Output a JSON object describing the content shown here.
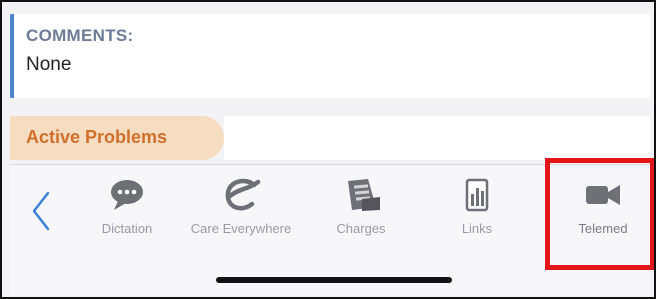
{
  "comments": {
    "label": "COMMENTS:",
    "value": "None"
  },
  "active_problems": {
    "label": "Active Problems"
  },
  "toolbar": {
    "items": [
      {
        "label": "Dictation",
        "icon": "dictation-icon"
      },
      {
        "label": "Care Everywhere",
        "icon": "care-everywhere-icon"
      },
      {
        "label": "Charges",
        "icon": "charges-icon"
      },
      {
        "label": "Links",
        "icon": "links-icon"
      },
      {
        "label": "Telemed",
        "icon": "video-camera-icon"
      }
    ],
    "back_icon": "chevron-left-icon"
  },
  "colors": {
    "accent_blue": "#4a86c8",
    "problems_text": "#d26f2b",
    "problems_bg": "#f6dcc1",
    "highlight": "#e3151a",
    "icon_gray": "#6f6f76"
  }
}
